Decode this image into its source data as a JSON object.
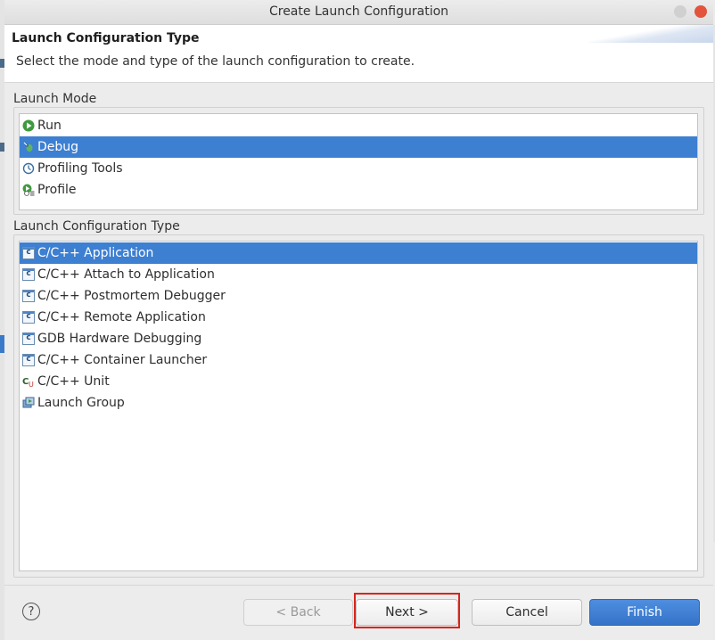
{
  "window": {
    "title": "Create Launch Configuration"
  },
  "header": {
    "title": "Launch Configuration Type",
    "description": "Select the mode and type of the launch configuration to create."
  },
  "launch_mode": {
    "label": "Launch Mode",
    "items": [
      {
        "label": "Run",
        "icon": "run-icon",
        "selected": false
      },
      {
        "label": "Debug",
        "icon": "debug-icon",
        "selected": true
      },
      {
        "label": "Profiling Tools",
        "icon": "profiling-tools-icon",
        "selected": false
      },
      {
        "label": "Profile",
        "icon": "profile-icon",
        "selected": false
      }
    ]
  },
  "launch_type": {
    "label": "Launch Configuration Type",
    "items": [
      {
        "label": "C/C++ Application",
        "icon": "c-application-icon",
        "selected": true
      },
      {
        "label": "C/C++ Attach to Application",
        "icon": "c-application-icon",
        "selected": false
      },
      {
        "label": "C/C++ Postmortem Debugger",
        "icon": "c-application-icon",
        "selected": false
      },
      {
        "label": "C/C++ Remote Application",
        "icon": "c-application-icon",
        "selected": false
      },
      {
        "label": "GDB Hardware Debugging",
        "icon": "c-application-icon",
        "selected": false
      },
      {
        "label": "C/C++ Container Launcher",
        "icon": "c-application-icon",
        "selected": false
      },
      {
        "label": "C/C++ Unit",
        "icon": "c-unit-icon",
        "selected": false
      },
      {
        "label": "Launch Group",
        "icon": "launch-group-icon",
        "selected": false
      }
    ]
  },
  "footer": {
    "help_glyph": "?",
    "back_label": "< Back",
    "next_label": "Next >",
    "cancel_label": "Cancel",
    "finish_label": "Finish"
  },
  "colors": {
    "selection": "#3d7fd1",
    "primary_button": "#3573c8",
    "focus_highlight": "#d9241c"
  }
}
